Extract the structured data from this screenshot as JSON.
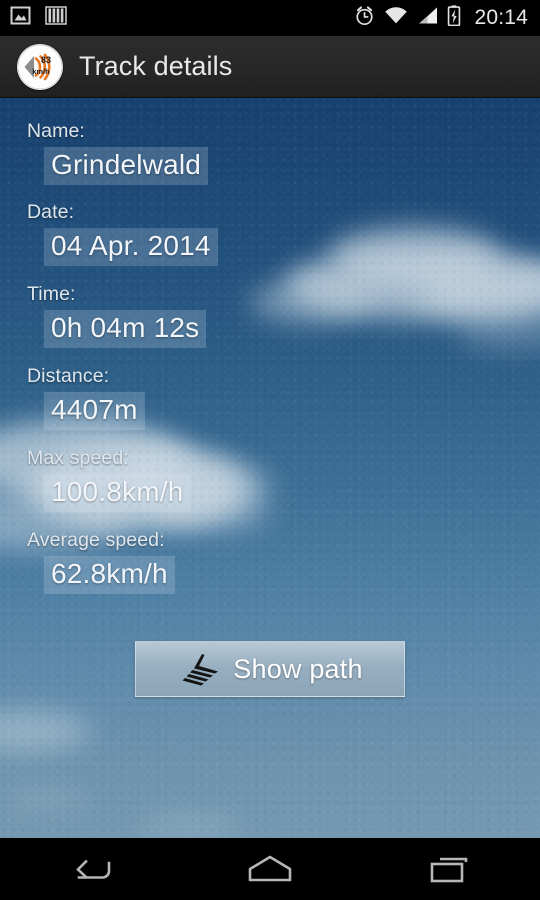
{
  "status_bar": {
    "left_icons": [
      "image-icon",
      "bars-icon"
    ],
    "right_icons": [
      "alarm-icon",
      "wifi-icon",
      "signal-icon",
      "battery-charging-icon"
    ],
    "clock": "20:14"
  },
  "action_bar": {
    "app_icon": "speedometer-icon",
    "app_icon_speed": "83",
    "app_icon_unit": "km/h",
    "title": "Track details"
  },
  "fields": [
    {
      "label": "Name:",
      "value": "Grindelwald"
    },
    {
      "label": "Date:",
      "value": "04 Apr. 2014"
    },
    {
      "label": "Time:",
      "value": "0h 04m 12s"
    },
    {
      "label": "Distance:",
      "value": "4407m"
    },
    {
      "label": "Max speed:",
      "value": "100.8km/h"
    },
    {
      "label": "Average speed:",
      "value": "62.8km/h"
    }
  ],
  "button": {
    "icon": "path-track-icon",
    "label": "Show path"
  },
  "nav_bar": {
    "back": "back-icon",
    "home": "home-icon",
    "recents": "recents-icon"
  },
  "colors": {
    "sky_top": "#17406e",
    "sky_bottom": "#7599b1",
    "action_bar": "#272727",
    "accent_orange": "#e8761e",
    "text_primary": "#f2f6fa",
    "text_label": "#dfe7ee"
  }
}
